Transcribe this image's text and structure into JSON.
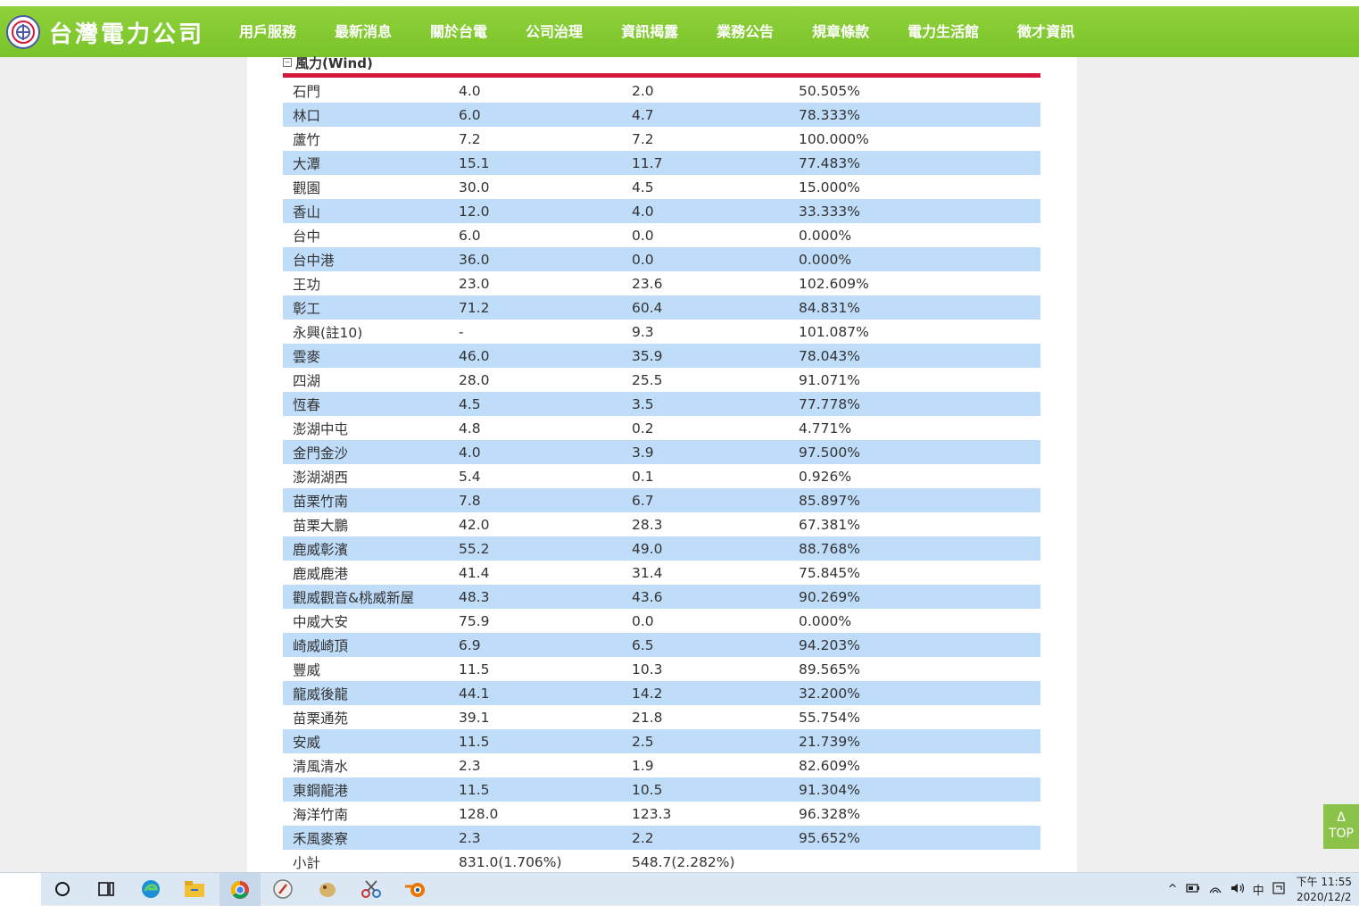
{
  "header": {
    "logo_text": "台灣電力公司",
    "nav": [
      {
        "label": "用戶服務"
      },
      {
        "label": "最新消息"
      },
      {
        "label": "關於台電"
      },
      {
        "label": "公司治理"
      },
      {
        "label": "資訊揭露",
        "active": true
      },
      {
        "label": "業務公告"
      },
      {
        "label": "規章條款"
      },
      {
        "label": "電力生活館"
      },
      {
        "label": "徵才資訊"
      }
    ]
  },
  "section": {
    "collapse_glyph": "−",
    "title": "風力(Wind)"
  },
  "table": {
    "rows": [
      [
        "石門",
        "4.0",
        "2.0",
        "50.505%"
      ],
      [
        "林口",
        "6.0",
        "4.7",
        "78.333%"
      ],
      [
        "蘆竹",
        "7.2",
        "7.2",
        "100.000%"
      ],
      [
        "大潭",
        "15.1",
        "11.7",
        "77.483%"
      ],
      [
        "觀園",
        "30.0",
        "4.5",
        "15.000%"
      ],
      [
        "香山",
        "12.0",
        "4.0",
        "33.333%"
      ],
      [
        "台中",
        "6.0",
        "0.0",
        "0.000%"
      ],
      [
        "台中港",
        "36.0",
        "0.0",
        "0.000%"
      ],
      [
        "王功",
        "23.0",
        "23.6",
        "102.609%"
      ],
      [
        "彰工",
        "71.2",
        "60.4",
        "84.831%"
      ],
      [
        "永興(註10)",
        "-",
        "9.3",
        "101.087%"
      ],
      [
        "雲麥",
        "46.0",
        "35.9",
        "78.043%"
      ],
      [
        "四湖",
        "28.0",
        "25.5",
        "91.071%"
      ],
      [
        "恆春",
        "4.5",
        "3.5",
        "77.778%"
      ],
      [
        "澎湖中屯",
        "4.8",
        "0.2",
        "4.771%"
      ],
      [
        "金門金沙",
        "4.0",
        "3.9",
        "97.500%"
      ],
      [
        "澎湖湖西",
        "5.4",
        "0.1",
        "0.926%"
      ],
      [
        "苗栗竹南",
        "7.8",
        "6.7",
        "85.897%"
      ],
      [
        "苗栗大鵬",
        "42.0",
        "28.3",
        "67.381%"
      ],
      [
        "鹿威彰濱",
        "55.2",
        "49.0",
        "88.768%"
      ],
      [
        "鹿威鹿港",
        "41.4",
        "31.4",
        "75.845%"
      ],
      [
        "觀威觀音&桃威新屋",
        "48.3",
        "43.6",
        "90.269%"
      ],
      [
        "中威大安",
        "75.9",
        "0.0",
        "0.000%"
      ],
      [
        "崎威崎頂",
        "6.9",
        "6.5",
        "94.203%"
      ],
      [
        "豐威",
        "11.5",
        "10.3",
        "89.565%"
      ],
      [
        "龍威後龍",
        "44.1",
        "14.2",
        "32.200%"
      ],
      [
        "苗栗通苑",
        "39.1",
        "21.8",
        "55.754%"
      ],
      [
        "安威",
        "11.5",
        "2.5",
        "21.739%"
      ],
      [
        "清風清水",
        "2.3",
        "1.9",
        "82.609%"
      ],
      [
        "東鋼龍港",
        "11.5",
        "10.5",
        "91.304%"
      ],
      [
        "海洋竹南",
        "128.0",
        "123.3",
        "96.328%"
      ],
      [
        "禾風麥寮",
        "2.3",
        "2.2",
        "95.652%"
      ],
      [
        "小計",
        "831.0(1.706%)",
        "548.7(2.282%)",
        ""
      ]
    ]
  },
  "top_button": {
    "arrow": "Δ",
    "label": "TOP"
  },
  "taskbar": {
    "icons": [
      "search-circle-icon",
      "task-view-icon",
      "edge-icon",
      "file-explorer-icon",
      "chrome-icon",
      "compass-app-icon",
      "bird-app-icon",
      "scissors-app-icon",
      "blender-icon"
    ],
    "tray": {
      "chevron": "^",
      "ime": "中",
      "time": "下午 11:55",
      "date": "2020/12/2"
    }
  },
  "colors": {
    "header_green": "#7ac42a",
    "accent_red": "#d4173b",
    "row_blue": "#bfdcf9",
    "page_gray": "#efefef"
  }
}
